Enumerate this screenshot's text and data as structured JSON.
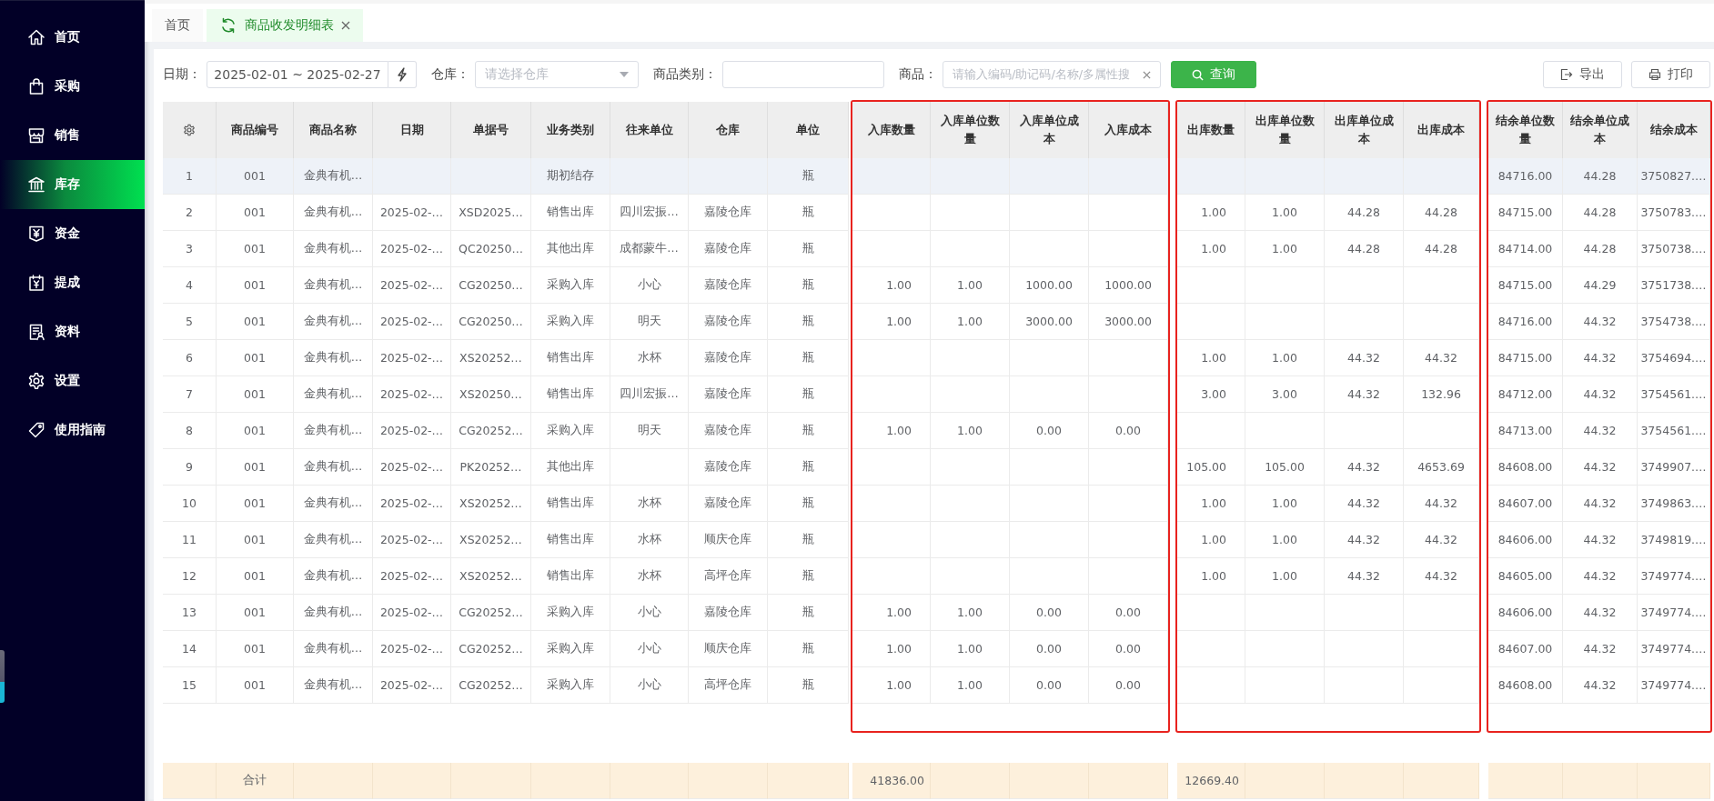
{
  "sidebar": {
    "items": [
      {
        "label": "首页",
        "selected": false
      },
      {
        "label": "采购",
        "selected": false
      },
      {
        "label": "销售",
        "selected": false
      },
      {
        "label": "库存",
        "selected": true
      },
      {
        "label": "资金",
        "selected": false
      },
      {
        "label": "提成",
        "selected": false
      },
      {
        "label": "资料",
        "selected": false
      },
      {
        "label": "设置",
        "selected": false
      },
      {
        "label": "使用指南",
        "selected": false
      }
    ]
  },
  "tabs": [
    {
      "label": "首页",
      "selected": false,
      "closable": false
    },
    {
      "label": "商品收发明细表",
      "selected": true,
      "closable": true
    }
  ],
  "filters": {
    "date": {
      "label": "日期：",
      "value": "2025-02-01 ~ 2025-02-27"
    },
    "warehouse": {
      "label": "仓库：",
      "placeholder": "请选择仓库"
    },
    "category": {
      "label": "商品类别："
    },
    "product": {
      "label": "商品：",
      "placeholder": "请输入编码/助记码/名称/多属性搜"
    },
    "search_button": "查询",
    "actions": [
      "导出",
      "打印"
    ]
  },
  "table": {
    "column_groups": [
      {
        "columns": [
          "商品编号",
          "商品名称",
          "日期",
          "单据号",
          "业务类别",
          "往来单位",
          "仓库",
          "单位"
        ]
      },
      {
        "framed": true,
        "columns": [
          "入库数量",
          "入库单位数量",
          "入库单位成本",
          "入库成本"
        ]
      },
      {
        "framed": true,
        "columns": [
          "出库数量",
          "出库单位数量",
          "出库单位成本",
          "出库成本"
        ]
      },
      {
        "framed": true,
        "columns": [
          "结余单位数量",
          "结余单位成本",
          "结余成本"
        ]
      }
    ],
    "rows": [
      {
        "no": "1",
        "selected": true,
        "cells": [
          "001",
          "金典有机…",
          null,
          null,
          "期初结存",
          null,
          null,
          "瓶",
          null,
          null,
          null,
          null,
          null,
          null,
          null,
          null,
          "84716.00",
          "44.28",
          "3750827.…"
        ]
      },
      {
        "no": "2",
        "selected": false,
        "cells": [
          "001",
          "金典有机…",
          "2025-02-…",
          "XSD2025…",
          "销售出库",
          "四川宏振…",
          "嘉陵仓库",
          "瓶",
          null,
          null,
          null,
          null,
          "1.00",
          "1.00",
          "44.28",
          "44.28",
          "84715.00",
          "44.28",
          "3750783.…"
        ]
      },
      {
        "no": "3",
        "selected": false,
        "cells": [
          "001",
          "金典有机…",
          "2025-02-…",
          "QC20250…",
          "其他出库",
          "成都蒙牛…",
          "嘉陵仓库",
          "瓶",
          null,
          null,
          null,
          null,
          "1.00",
          "1.00",
          "44.28",
          "44.28",
          "84714.00",
          "44.28",
          "3750738.…"
        ]
      },
      {
        "no": "4",
        "selected": false,
        "cells": [
          "001",
          "金典有机…",
          "2025-02-…",
          "CG20250…",
          "采购入库",
          "小心",
          "嘉陵仓库",
          "瓶",
          "1.00",
          "1.00",
          "1000.00",
          "1000.00",
          null,
          null,
          null,
          null,
          "84715.00",
          "44.29",
          "3751738.…"
        ]
      },
      {
        "no": "5",
        "selected": false,
        "cells": [
          "001",
          "金典有机…",
          "2025-02-…",
          "CG20250…",
          "采购入库",
          "明天",
          "嘉陵仓库",
          "瓶",
          "1.00",
          "1.00",
          "3000.00",
          "3000.00",
          null,
          null,
          null,
          null,
          "84716.00",
          "44.32",
          "3754738.…"
        ]
      },
      {
        "no": "6",
        "selected": false,
        "cells": [
          "001",
          "金典有机…",
          "2025-02-…",
          "XS20252…",
          "销售出库",
          "水杯",
          "嘉陵仓库",
          "瓶",
          null,
          null,
          null,
          null,
          "1.00",
          "1.00",
          "44.32",
          "44.32",
          "84715.00",
          "44.32",
          "3754694.…"
        ]
      },
      {
        "no": "7",
        "selected": false,
        "cells": [
          "001",
          "金典有机…",
          "2025-02-…",
          "XS20250…",
          "销售出库",
          "四川宏振…",
          "嘉陵仓库",
          "瓶",
          null,
          null,
          null,
          null,
          "3.00",
          "3.00",
          "44.32",
          "132.96",
          "84712.00",
          "44.32",
          "3754561.…"
        ]
      },
      {
        "no": "8",
        "selected": false,
        "cells": [
          "001",
          "金典有机…",
          "2025-02-…",
          "CG20252…",
          "采购入库",
          "明天",
          "嘉陵仓库",
          "瓶",
          "1.00",
          "1.00",
          "0.00",
          "0.00",
          null,
          null,
          null,
          null,
          "84713.00",
          "44.32",
          "3754561.…"
        ]
      },
      {
        "no": "9",
        "selected": false,
        "cells": [
          "001",
          "金典有机…",
          "2025-02-…",
          "PK20252…",
          "其他出库",
          null,
          "嘉陵仓库",
          "瓶",
          null,
          null,
          null,
          null,
          "105.00",
          "105.00",
          "44.32",
          "4653.69",
          "84608.00",
          "44.32",
          "3749907.…"
        ]
      },
      {
        "no": "10",
        "selected": false,
        "cells": [
          "001",
          "金典有机…",
          "2025-02-…",
          "XS20252…",
          "销售出库",
          "水杯",
          "嘉陵仓库",
          "瓶",
          null,
          null,
          null,
          null,
          "1.00",
          "1.00",
          "44.32",
          "44.32",
          "84607.00",
          "44.32",
          "3749863.…"
        ]
      },
      {
        "no": "11",
        "selected": false,
        "cells": [
          "001",
          "金典有机…",
          "2025-02-…",
          "XS20252…",
          "销售出库",
          "水杯",
          "顺庆仓库",
          "瓶",
          null,
          null,
          null,
          null,
          "1.00",
          "1.00",
          "44.32",
          "44.32",
          "84606.00",
          "44.32",
          "3749819.…"
        ]
      },
      {
        "no": "12",
        "selected": false,
        "cells": [
          "001",
          "金典有机…",
          "2025-02-…",
          "XS20252…",
          "销售出库",
          "水杯",
          "高坪仓库",
          "瓶",
          null,
          null,
          null,
          null,
          "1.00",
          "1.00",
          "44.32",
          "44.32",
          "84605.00",
          "44.32",
          "3749774.…"
        ]
      },
      {
        "no": "13",
        "selected": false,
        "cells": [
          "001",
          "金典有机…",
          "2025-02-…",
          "CG20252…",
          "采购入库",
          "小心",
          "嘉陵仓库",
          "瓶",
          "1.00",
          "1.00",
          "0.00",
          "0.00",
          null,
          null,
          null,
          null,
          "84606.00",
          "44.32",
          "3749774.…"
        ]
      },
      {
        "no": "14",
        "selected": false,
        "cells": [
          "001",
          "金典有机…",
          "2025-02-…",
          "CG20252…",
          "采购入库",
          "小心",
          "顺庆仓库",
          "瓶",
          "1.00",
          "1.00",
          "0.00",
          "0.00",
          null,
          null,
          null,
          null,
          "84607.00",
          "44.32",
          "3749774.…"
        ]
      },
      {
        "no": "15",
        "selected": false,
        "cells": [
          "001",
          "金典有机…",
          "2025-02-…",
          "CG20252…",
          "采购入库",
          "小心",
          "高坪仓库",
          "瓶",
          "1.00",
          "1.00",
          "0.00",
          "0.00",
          null,
          null,
          null,
          null,
          "84608.00",
          "44.32",
          "3749774.…"
        ]
      }
    ],
    "total_row": {
      "cells": [
        "合计",
        null,
        null,
        null,
        null,
        null,
        null,
        null,
        "41836.00",
        null,
        null,
        null,
        "12669.40",
        null,
        null,
        null,
        null,
        null,
        null
      ]
    }
  }
}
